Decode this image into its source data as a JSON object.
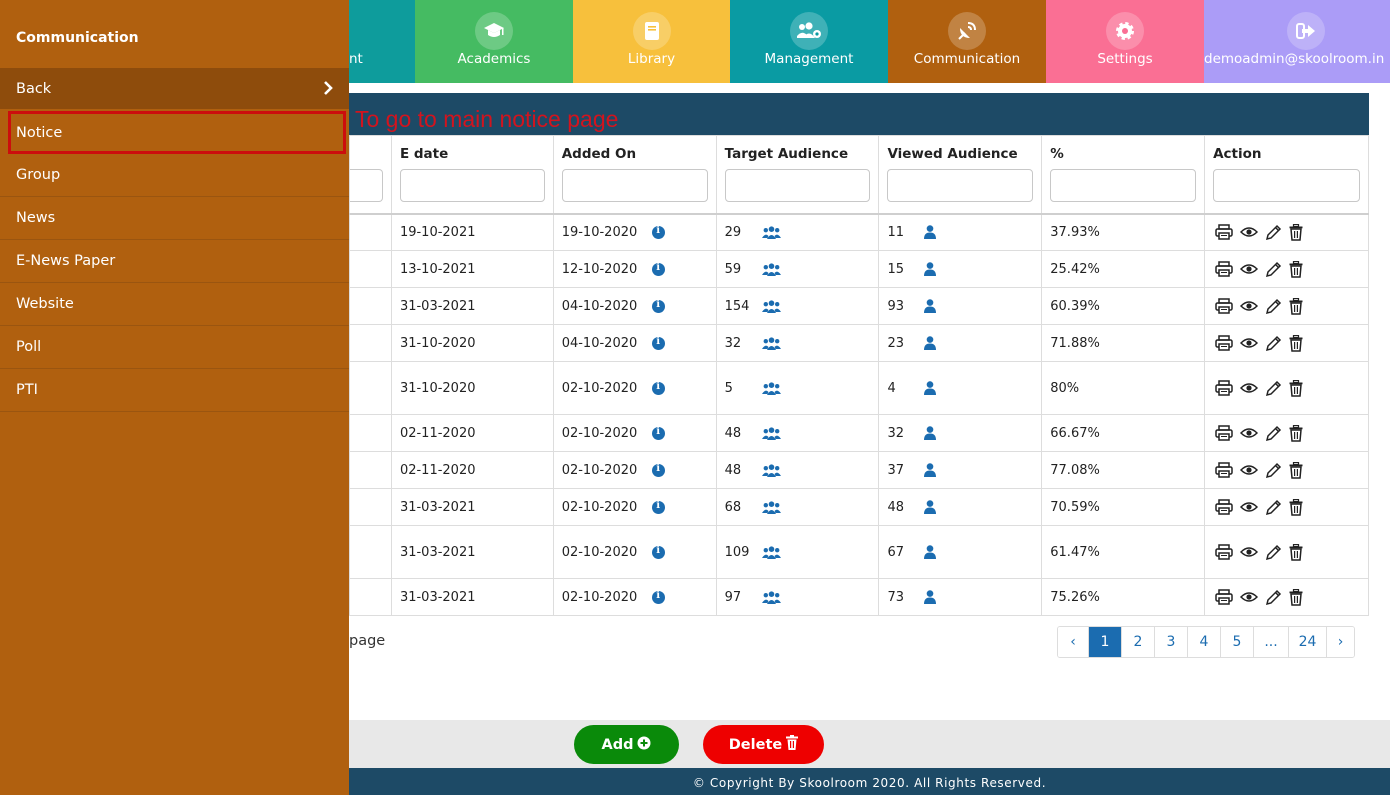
{
  "sidebar": {
    "title": "Communication",
    "back_label": "Back",
    "items": [
      {
        "label": "Notice"
      },
      {
        "label": "Group"
      },
      {
        "label": "News"
      },
      {
        "label": "E-News Paper"
      },
      {
        "label": "Website"
      },
      {
        "label": "Poll"
      },
      {
        "label": "PTI"
      }
    ]
  },
  "topnav": {
    "tiles": [
      {
        "label": "nt",
        "color": "#0e9c9c",
        "icon": "partial-icon"
      },
      {
        "label": "Academics",
        "color": "#45bb62",
        "icon": "graduation-cap-icon"
      },
      {
        "label": "Library",
        "color": "#f7c03c",
        "icon": "book-icon"
      },
      {
        "label": "Management",
        "color": "#0a9ba3",
        "icon": "users-cog-icon"
      },
      {
        "label": "Communication",
        "color": "#b0600f",
        "icon": "satellite-dish-icon"
      },
      {
        "label": "Settings",
        "color": "#fa6f94",
        "icon": "gear-icon"
      },
      {
        "label": "demoadmin@skoolroom.in",
        "color": "#ab9cf7",
        "icon": "sign-out-icon"
      }
    ]
  },
  "annotation": "To go to main notice page",
  "table": {
    "headers": {
      "edate": "E date",
      "added_on": "Added On",
      "target": "Target Audience",
      "viewed": "Viewed Audience",
      "percent": "%",
      "action": "Action"
    },
    "rows": [
      {
        "edate": "19-10-2021",
        "added": "19-10-2020",
        "target": "29",
        "viewed": "11",
        "percent": "37.93%"
      },
      {
        "edate": "13-10-2021",
        "added": "12-10-2020",
        "target": "59",
        "viewed": "15",
        "percent": "25.42%"
      },
      {
        "edate": "31-03-2021",
        "added": "04-10-2020",
        "target": "154",
        "viewed": "93",
        "percent": "60.39%"
      },
      {
        "edate": "31-10-2020",
        "added": "04-10-2020",
        "target": "32",
        "viewed": "23",
        "percent": "71.88%"
      },
      {
        "edate": "31-10-2020",
        "added": "02-10-2020",
        "target": "5",
        "viewed": "4",
        "percent": "80%"
      },
      {
        "edate": "02-11-2020",
        "added": "02-10-2020",
        "target": "48",
        "viewed": "32",
        "percent": "66.67%"
      },
      {
        "edate": "02-11-2020",
        "added": "02-10-2020",
        "target": "48",
        "viewed": "37",
        "percent": "77.08%"
      },
      {
        "edate": "31-03-2021",
        "added": "02-10-2020",
        "target": "68",
        "viewed": "48",
        "percent": "70.59%"
      },
      {
        "edate": "31-03-2021",
        "added": "02-10-2020",
        "target": "109",
        "viewed": "67",
        "percent": "61.47%"
      },
      {
        "edate": "31-03-2021",
        "added": "02-10-2020",
        "target": "97",
        "viewed": "73",
        "percent": "75.26%"
      }
    ]
  },
  "pagination": {
    "per_page_text": "page",
    "prev": "‹",
    "pages": [
      "1",
      "2",
      "3",
      "4",
      "5",
      "...",
      "24"
    ],
    "next": "›",
    "current": "1"
  },
  "buttons": {
    "add": "Add",
    "delete": "Delete"
  },
  "footer": "© Copyright By Skoolroom 2020. All Rights Reserved.",
  "colors": {
    "sidebar": "#b0600f",
    "header_band": "#1d4a66",
    "link_blue": "#1b6cb0",
    "add_green": "#0a8a0a",
    "delete_red": "#ee0000",
    "annotation_red": "#d2141e"
  }
}
